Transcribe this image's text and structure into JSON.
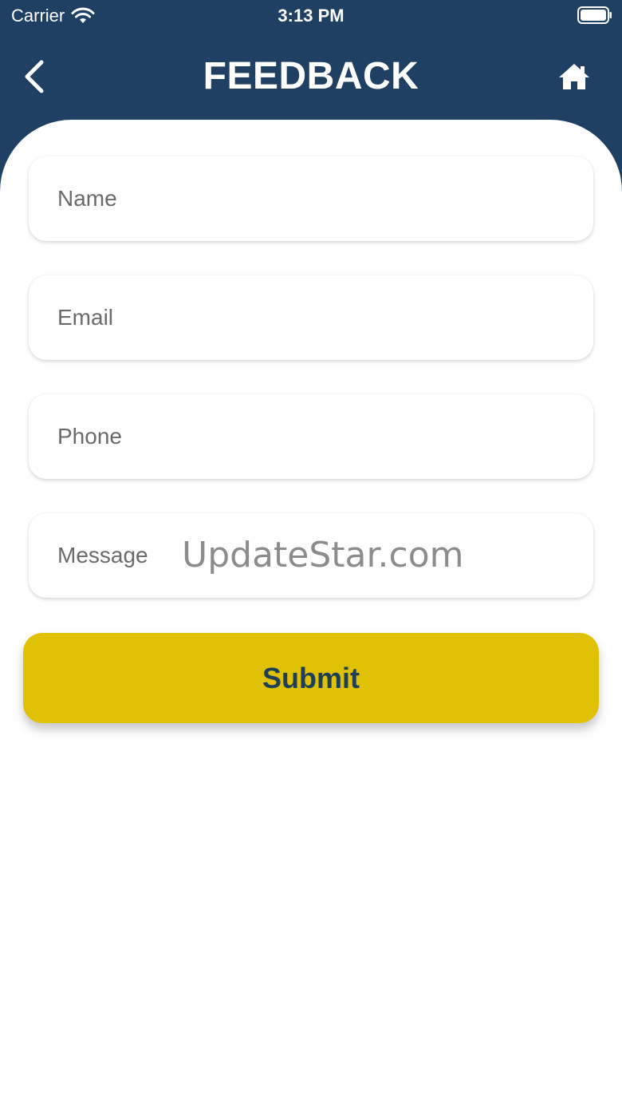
{
  "status_bar": {
    "carrier": "Carrier",
    "time": "3:13 PM"
  },
  "header": {
    "title": "FEEDBACK",
    "back_icon": "chevron-left-icon",
    "home_icon": "home-icon"
  },
  "form": {
    "name_placeholder": "Name",
    "email_placeholder": "Email",
    "phone_placeholder": "Phone",
    "message_placeholder": "Message",
    "submit_label": "Submit"
  },
  "watermark": "UpdateStar.com",
  "colors": {
    "header": "#1f3f63",
    "submit": "#e0c105",
    "submit_text": "#1f3f56"
  }
}
